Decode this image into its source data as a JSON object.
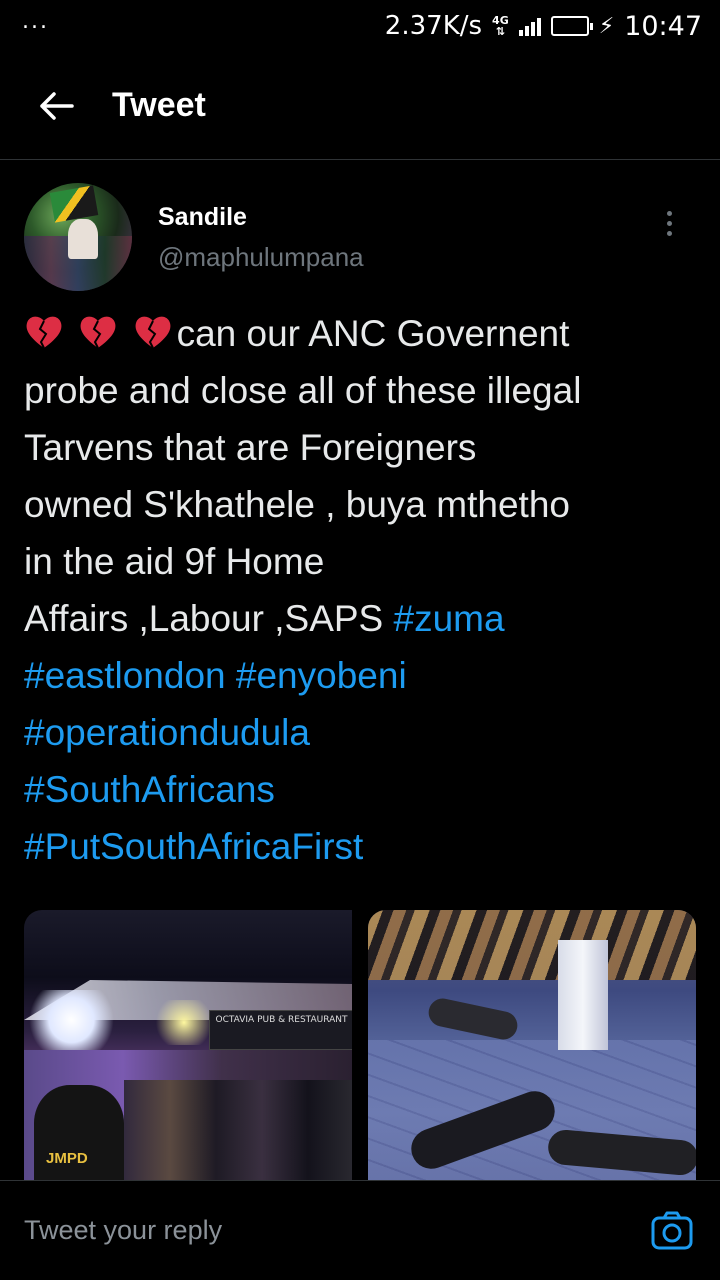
{
  "status_bar": {
    "dots": "...",
    "net_speed": "2.37K/s",
    "network_type": "4G",
    "battery_level": 0.95,
    "time": "10:47"
  },
  "header": {
    "title": "Tweet"
  },
  "tweet": {
    "author_name": "Sandile",
    "author_handle": "@maphulumpana",
    "text_lines": [
      "can our ANC Governent",
      "probe and close all of these illegal",
      "Tarvens that are Foreigners",
      "owned S'khathele , buya mthetho",
      "in the aid 9f Home",
      "Affairs ,Labour ,SAPS "
    ],
    "hashtags": [
      "#zuma",
      "#eastlondon",
      "#enyobeni",
      "#operationdudula",
      "#SouthAfricans",
      "#PutSouthAfricaFirst"
    ],
    "emoji": "broken-heart-icon",
    "media": [
      {
        "sign_text": "OCTAVIA PUB & RESTAURANT",
        "badge_text": "JMPD"
      },
      {
        "sign_text": ""
      }
    ]
  },
  "reply": {
    "placeholder": "Tweet your reply"
  },
  "colors": {
    "background": "#000000",
    "hashtag": "#1d9bf0",
    "secondary_text": "#6e767d",
    "divider": "#2f3336"
  }
}
